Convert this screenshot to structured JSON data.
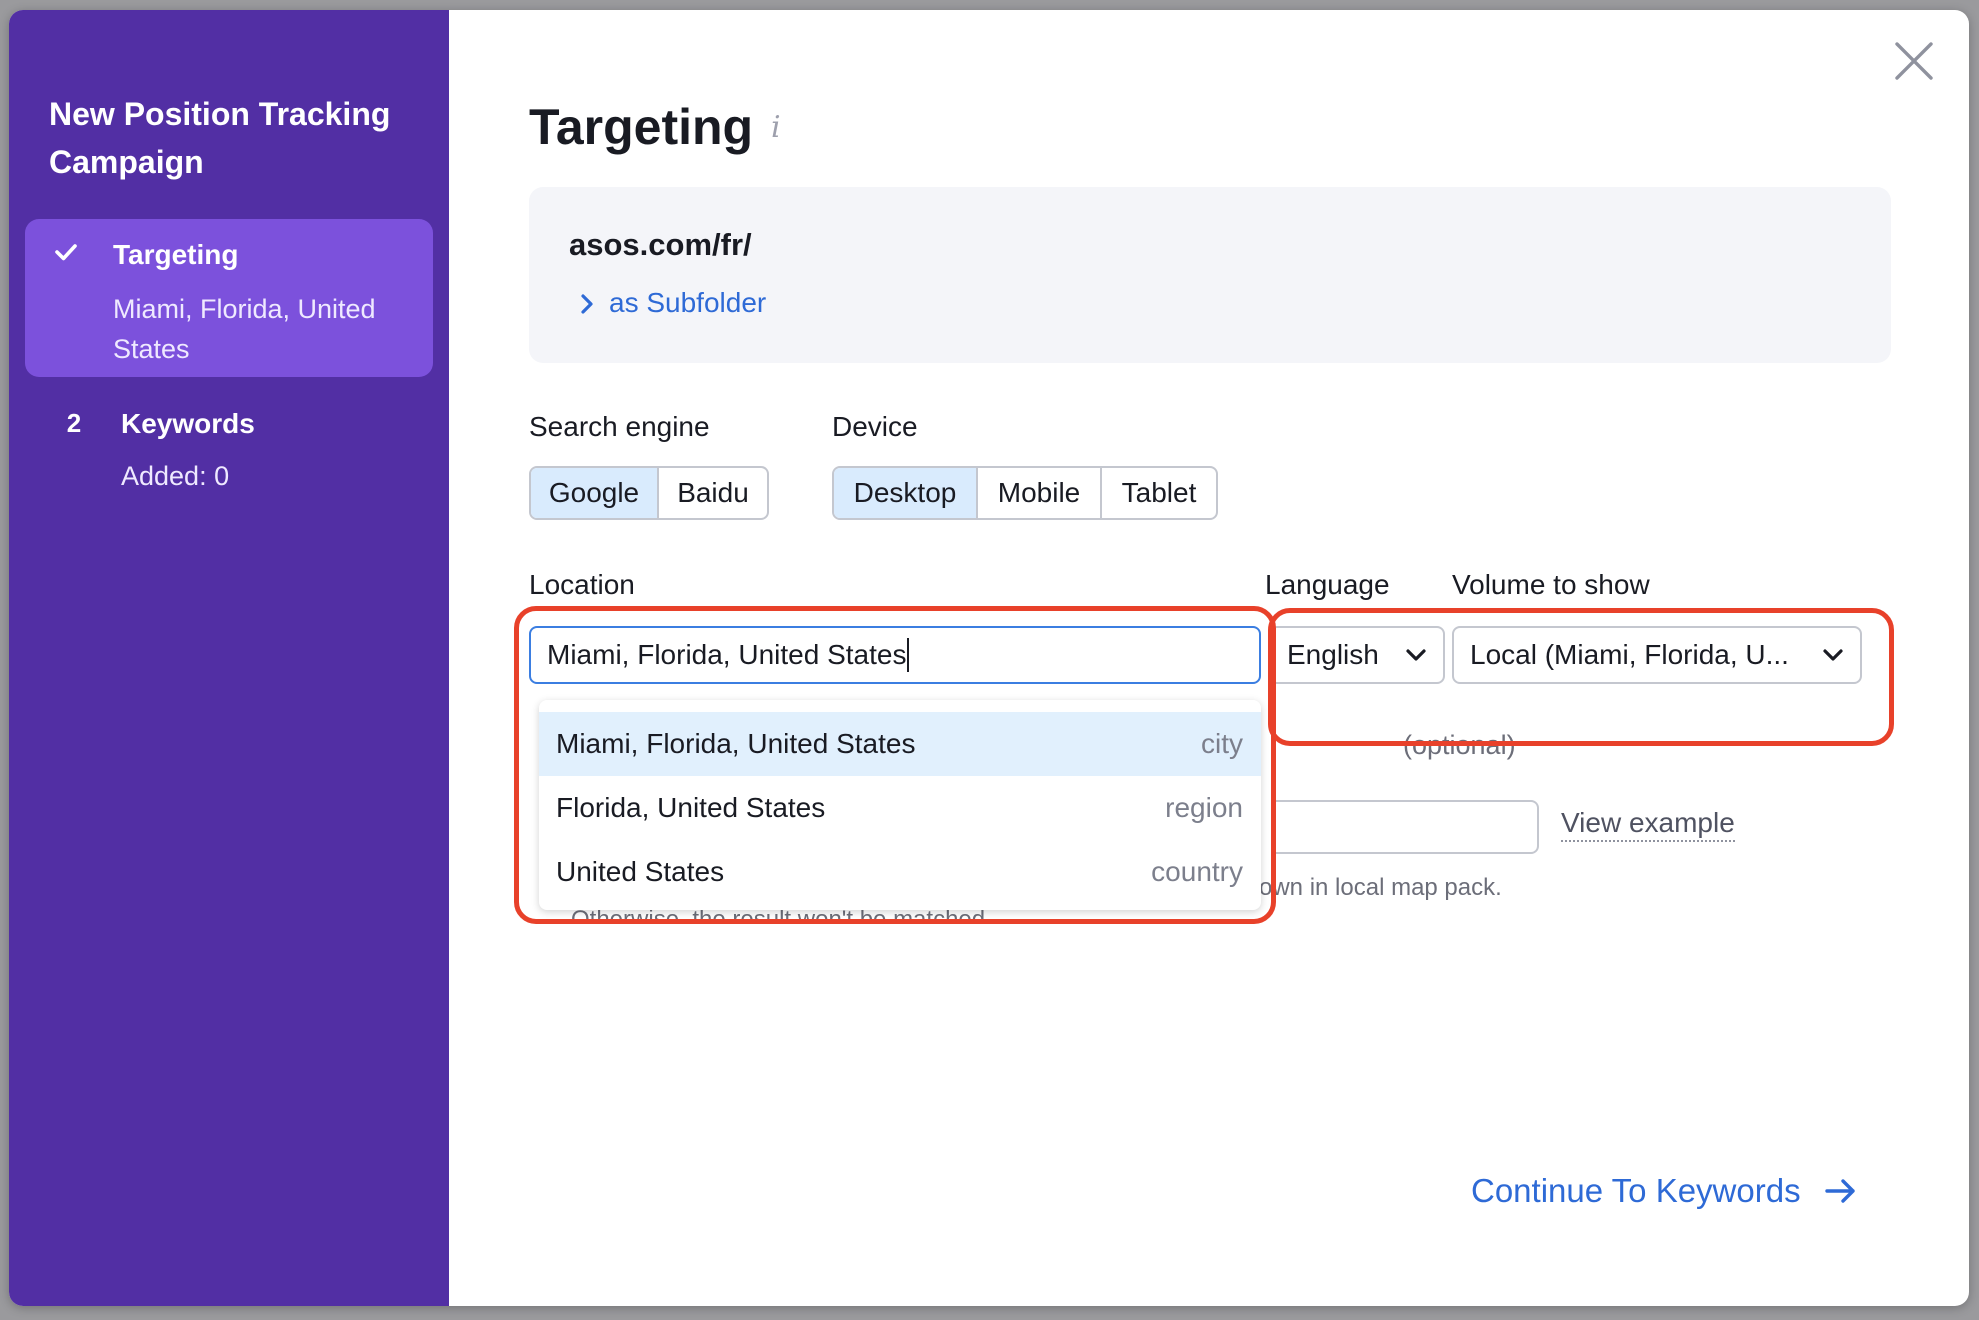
{
  "sidebar": {
    "title": "New Position Tracking Campaign",
    "steps": [
      {
        "marker": "✓",
        "name": "Targeting",
        "sub": "Miami, Florida, United States",
        "state": "active"
      },
      {
        "marker": "2",
        "name": "Keywords",
        "sub": "Added: 0",
        "state": "inactive"
      }
    ]
  },
  "header": {
    "title": "Targeting",
    "info_glyph": "i"
  },
  "domain_card": {
    "domain": "asos.com/fr/",
    "scope_link": "as Subfolder"
  },
  "search_engine": {
    "label": "Search engine",
    "options": [
      "Google",
      "Baidu"
    ],
    "selected": "Google"
  },
  "device": {
    "label": "Device",
    "options": [
      "Desktop",
      "Mobile",
      "Tablet"
    ],
    "selected": "Desktop"
  },
  "location": {
    "label": "Location",
    "value": "Miami, Florida, United States",
    "suggestions": [
      {
        "name": "Miami, Florida, United States",
        "type": "city"
      },
      {
        "name": "Florida, United States",
        "type": "region"
      },
      {
        "name": "United States",
        "type": "country"
      }
    ]
  },
  "language": {
    "label": "Language",
    "value": "English"
  },
  "volume": {
    "label": "Volume to show",
    "value": "Local (Miami, Florida, U..."
  },
  "obscured": {
    "optional": "(optional)",
    "view_example": "View example",
    "map_pack_hint": "own in local map pack.",
    "match_hint": "Otherwise, the result won't be matched."
  },
  "footer": {
    "continue_label": "Continue To Keywords"
  },
  "colors": {
    "sidebar_bg": "#522fa4",
    "active_step_bg": "#7c51dc",
    "accent_blue": "#2e6ad6",
    "selected_segment_bg": "#d9ebfd",
    "annotation_red": "#e8412a"
  },
  "icons": {
    "close": "close-icon",
    "check": "check-icon",
    "chevron_right": "chevron-right-icon",
    "chevron_down": "chevron-down-icon",
    "arrow_right": "arrow-right-icon",
    "info": "info-icon"
  }
}
